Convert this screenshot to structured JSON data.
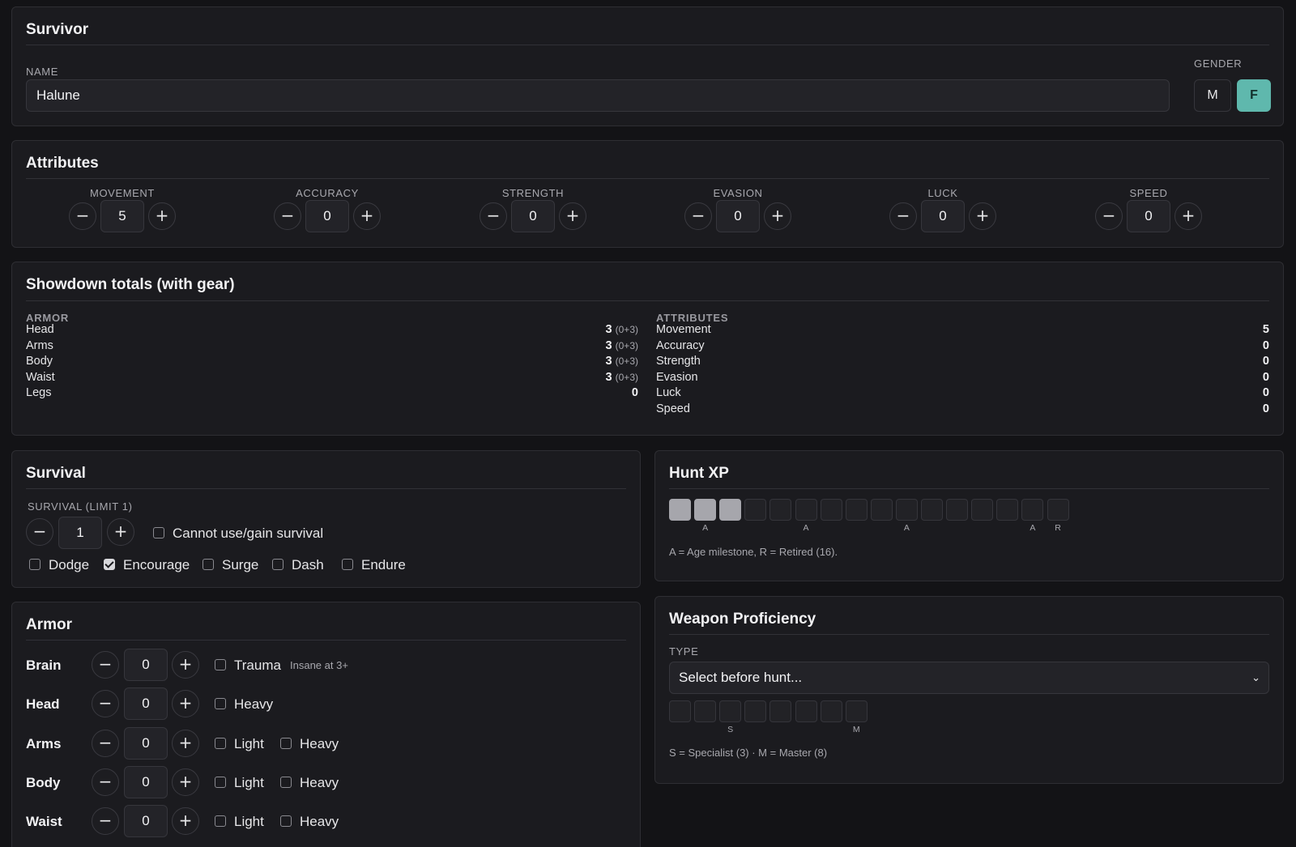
{
  "survivor": {
    "title": "Survivor",
    "name_label": "NAME",
    "name_value": "Halune",
    "gender_label": "GENDER",
    "gender_m": "M",
    "gender_f": "F",
    "gender_selected": "F"
  },
  "attributes": {
    "title": "Attributes",
    "items": [
      {
        "label": "MOVEMENT",
        "value": "5"
      },
      {
        "label": "ACCURACY",
        "value": "0"
      },
      {
        "label": "STRENGTH",
        "value": "0"
      },
      {
        "label": "EVASION",
        "value": "0"
      },
      {
        "label": "LUCK",
        "value": "0"
      },
      {
        "label": "SPEED",
        "value": "0"
      }
    ],
    "minus": "−",
    "plus": "+"
  },
  "totals": {
    "title": "Showdown totals (with gear)",
    "armor_heading": "ARMOR",
    "armor_rows": [
      {
        "label": "Head",
        "value": "3",
        "sub": "(0+3)"
      },
      {
        "label": "Arms",
        "value": "3",
        "sub": "(0+3)"
      },
      {
        "label": "Body",
        "value": "3",
        "sub": "(0+3)"
      },
      {
        "label": "Waist",
        "value": "3",
        "sub": "(0+3)"
      },
      {
        "label": "Legs",
        "value": "0",
        "sub": ""
      }
    ],
    "attr_heading": "ATTRIBUTES",
    "attr_rows": [
      {
        "label": "Movement",
        "value": "5"
      },
      {
        "label": "Accuracy",
        "value": "0"
      },
      {
        "label": "Strength",
        "value": "0"
      },
      {
        "label": "Evasion",
        "value": "0"
      },
      {
        "label": "Luck",
        "value": "0"
      },
      {
        "label": "Speed",
        "value": "0"
      }
    ]
  },
  "survival": {
    "title": "Survival",
    "label": "SURVIVAL (LIMIT 1)",
    "value": "1",
    "cannot_label": "Cannot use/gain survival",
    "cannot_checked": false,
    "abilities": [
      {
        "label": "Dodge",
        "checked": false
      },
      {
        "label": "Encourage",
        "checked": true
      },
      {
        "label": "Surge",
        "checked": false
      },
      {
        "label": "Dash",
        "checked": false
      },
      {
        "label": "Endure",
        "checked": false
      }
    ]
  },
  "armor": {
    "title": "Armor",
    "rows": [
      {
        "name": "Brain",
        "value": "0",
        "checks": [
          "Trauma"
        ],
        "note": "Insane at 3+"
      },
      {
        "name": "Head",
        "value": "0",
        "checks": [
          "Heavy"
        ],
        "note": ""
      },
      {
        "name": "Arms",
        "value": "0",
        "checks": [
          "Light",
          "Heavy"
        ],
        "note": ""
      },
      {
        "name": "Body",
        "value": "0",
        "checks": [
          "Light",
          "Heavy"
        ],
        "note": ""
      },
      {
        "name": "Waist",
        "value": "0",
        "checks": [
          "Light",
          "Heavy"
        ],
        "note": ""
      }
    ]
  },
  "hunt_xp": {
    "title": "Hunt XP",
    "filled": 3,
    "total": 16,
    "markers": [
      "",
      "A",
      "",
      "",
      "",
      "A",
      "",
      "",
      "",
      "A",
      "",
      "",
      "",
      "",
      "A",
      "R"
    ],
    "note": "A = Age milestone, R = Retired (16)."
  },
  "weapon": {
    "title": "Weapon Proficiency",
    "type_label": "TYPE",
    "select_value": "Select before hunt...",
    "filled": 0,
    "total": 8,
    "markers": [
      "",
      "",
      "S",
      "",
      "",
      "",
      "",
      "M"
    ],
    "note": "S = Specialist (3) · M = Master (8)"
  },
  "colors": {
    "accent": "#5fb8ad",
    "card_bg": "#1b1b1f",
    "page_bg": "#131316"
  }
}
